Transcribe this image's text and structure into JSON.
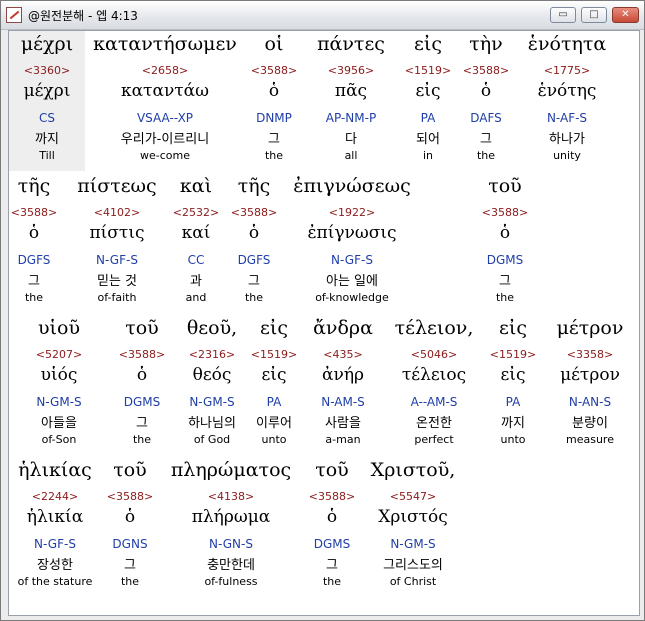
{
  "window": {
    "title": "@원전분해 - 엡 4:13",
    "buttons": {
      "minimize": "▭",
      "maximize": "□",
      "close": "✕"
    }
  },
  "rows": [
    [
      {
        "greek": "μέχρι",
        "strong": "<3360>",
        "lexeme": "μέχρι",
        "parse": "CS",
        "korean": "까지",
        "english": "Till"
      },
      {
        "greek": "καταντήσωμεν",
        "strong": "<2658>",
        "lexeme": "καταντάω",
        "parse": "VSAA--XP",
        "korean": "우리가-이르리니",
        "english": "we-come"
      },
      {
        "greek": "οἱ",
        "strong": "<3588>",
        "lexeme": "ὁ",
        "parse": "DNMP",
        "korean": "그",
        "english": "the"
      },
      {
        "greek": "πάντες",
        "strong": "<3956>",
        "lexeme": "πᾶς",
        "parse": "AP-NM-P",
        "korean": "다",
        "english": "all"
      },
      {
        "greek": "εἰς",
        "strong": "<1519>",
        "lexeme": "εἰς",
        "parse": "PA",
        "korean": "되어",
        "english": "in"
      },
      {
        "greek": "τὴν",
        "strong": "<3588>",
        "lexeme": "ὁ",
        "parse": "DAFS",
        "korean": "그",
        "english": "the"
      },
      {
        "greek": "ἑνότητα",
        "strong": "<1775>",
        "lexeme": "ἑνότης",
        "parse": "N-AF-S",
        "korean": "하나가",
        "english": "unity"
      }
    ],
    [
      {
        "greek": "τῆς",
        "strong": "<3588>",
        "lexeme": "ὁ",
        "parse": "DGFS",
        "korean": "그",
        "english": "the"
      },
      {
        "greek": "πίστεως",
        "strong": "<4102>",
        "lexeme": "πίστις",
        "parse": "N-GF-S",
        "korean": "믿는 것",
        "english": "of-faith"
      },
      {
        "greek": "καὶ",
        "strong": "<2532>",
        "lexeme": "καί",
        "parse": "CC",
        "korean": "과",
        "english": "and"
      },
      {
        "greek": "τῆς",
        "strong": "<3588>",
        "lexeme": "ὁ",
        "parse": "DGFS",
        "korean": "그",
        "english": "the"
      },
      {
        "greek": "ἐπιγνώσεως",
        "strong": "<1922>",
        "lexeme": "ἐπίγνωσις",
        "parse": "N-GF-S",
        "korean": "아는 일에",
        "english": "of-knowledge"
      },
      {
        "greek": "τοῦ",
        "strong": "<3588>",
        "lexeme": "ὁ",
        "parse": "DGMS",
        "korean": "그",
        "english": "the"
      }
    ],
    [
      {
        "greek": "υἱοῦ",
        "strong": "<5207>",
        "lexeme": "υἱός",
        "parse": "N-GM-S",
        "korean": "아들을",
        "english": "of-Son"
      },
      {
        "greek": "τοῦ",
        "strong": "<3588>",
        "lexeme": "ὁ",
        "parse": "DGMS",
        "korean": "그",
        "english": "the"
      },
      {
        "greek": "θεοῦ,",
        "strong": "<2316>",
        "lexeme": "θεός",
        "parse": "N-GM-S",
        "korean": "하나님의",
        "english": "of God"
      },
      {
        "greek": "εἰς",
        "strong": "<1519>",
        "lexeme": "εἰς",
        "parse": "PA",
        "korean": "이루어",
        "english": "unto"
      },
      {
        "greek": "ἄνδρα",
        "strong": "<435>",
        "lexeme": "ἀνήρ",
        "parse": "N-AM-S",
        "korean": "사람을",
        "english": "a-man"
      },
      {
        "greek": "τέλειον,",
        "strong": "<5046>",
        "lexeme": "τέλειος",
        "parse": "A--AM-S",
        "korean": "온전한",
        "english": "perfect"
      },
      {
        "greek": "εἰς",
        "strong": "<1519>",
        "lexeme": "εἰς",
        "parse": "PA",
        "korean": "까지",
        "english": "unto"
      },
      {
        "greek": "μέτρον",
        "strong": "<3358>",
        "lexeme": "μέτρον",
        "parse": "N-AN-S",
        "korean": "분량이",
        "english": "measure"
      }
    ],
    [
      {
        "greek": "ἡλικίας",
        "strong": "<2244>",
        "lexeme": "ἡλικία",
        "parse": "N-GF-S",
        "korean": "장성한",
        "english": "of the stature"
      },
      {
        "greek": "τοῦ",
        "strong": "<3588>",
        "lexeme": "ὁ",
        "parse": "DGNS",
        "korean": "그",
        "english": "the"
      },
      {
        "greek": "πληρώματος",
        "strong": "<4138>",
        "lexeme": "πλήρωμα",
        "parse": "N-GN-S",
        "korean": "충만한데",
        "english": "of-fulness"
      },
      {
        "greek": "τοῦ",
        "strong": "<3588>",
        "lexeme": "ὁ",
        "parse": "DGMS",
        "korean": "그",
        "english": "the"
      },
      {
        "greek": "Χριστοῦ,",
        "strong": "<5547>",
        "lexeme": "Χριστός",
        "parse": "N-GM-S",
        "korean": "그리스도의",
        "english": "of Christ"
      }
    ]
  ]
}
